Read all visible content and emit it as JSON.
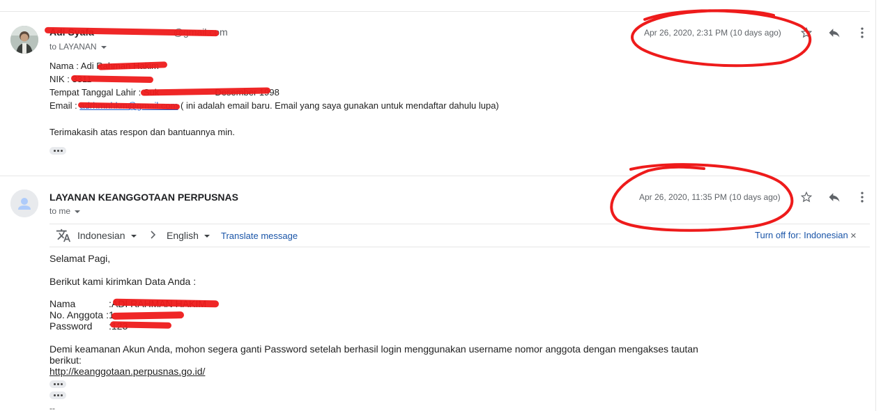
{
  "messages": [
    {
      "sender": "Adi Syafa",
      "sender_email": "@gmail.com",
      "to_label": "to LAYANAN",
      "date": "Apr 26, 2020, 2:31 PM (10 days ago)",
      "lines": [
        {
          "label": "Nama : ",
          "value": "Adi Rahman Hakim"
        },
        {
          "label": "NIK : ",
          "value": "3311"
        },
        {
          "label": "Tempat Tanggal Lahir : ",
          "value": "Suk",
          "suffix": "Desember 1998"
        },
        {
          "label": "Email : ",
          "link": "adrhmnhkm@gmail.com",
          "suffix": " ( ini adalah email baru. Email yang saya gunakan untuk mendaftar dahulu lupa)"
        }
      ],
      "closing": "Terimakasih atas respon dan bantuannya min."
    },
    {
      "sender": "LAYANAN KEANGGOTAAN PERPUSNAS",
      "to_label": "to me",
      "date": "Apr 26, 2020, 11:35 PM (10 days ago)",
      "translate": {
        "from_lang": "Indonesian",
        "to_lang": "English",
        "translate_link": "Translate message",
        "turn_off": "Turn off for: Indonesian"
      },
      "greeting": "Selamat Pagi,",
      "intro": "Berikut kami kirimkan Data Anda :",
      "fields": [
        {
          "label": "Nama",
          "sep": ": ",
          "value": "ADI RAHMAN HAKIM"
        },
        {
          "label": "No. Anggota",
          "sep": ": ",
          "value": "1"
        },
        {
          "label": "Password",
          "sep": ": ",
          "value": "123"
        }
      ],
      "notice": "Demi keamanan Akun Anda, mohon segera ganti Password setelah berhasil login menggunakan username nomor anggota dengan mengakses tautan berikut:",
      "url": "http://keanggotaan.perpusnas.go.id/",
      "signature_dash": "--"
    }
  ],
  "colors": {
    "annotation": "#ee1b1b",
    "link": "#1155cc"
  }
}
